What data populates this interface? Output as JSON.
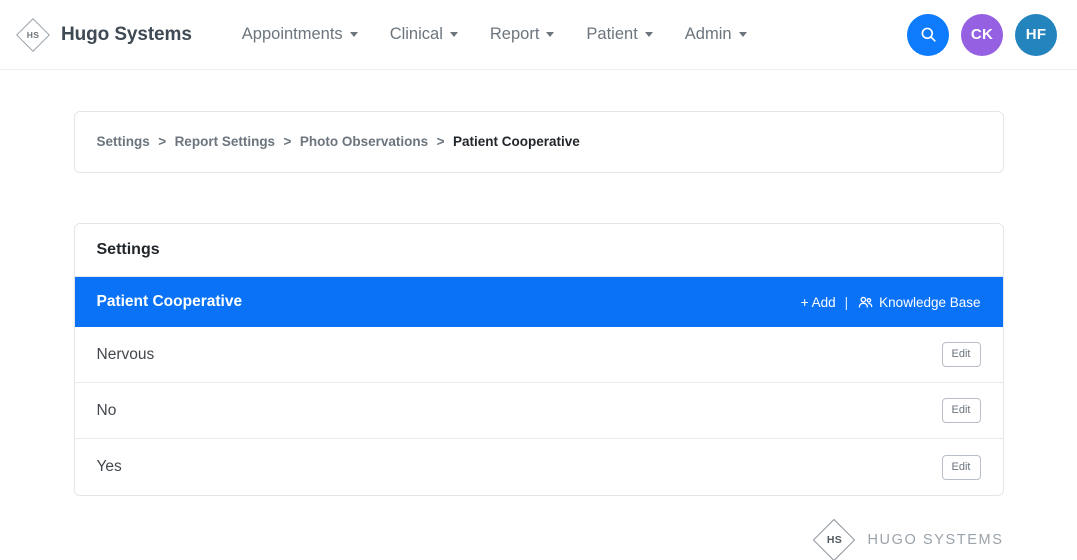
{
  "navbar": {
    "logo_text": "HS",
    "brand": "Hugo Systems",
    "menu": [
      {
        "label": "Appointments"
      },
      {
        "label": "Clinical"
      },
      {
        "label": "Report"
      },
      {
        "label": "Patient"
      },
      {
        "label": "Admin"
      }
    ],
    "search_icon": "search-icon",
    "avatars": [
      {
        "initials": "CK",
        "color": "#9561e2"
      },
      {
        "initials": "HF",
        "color": "#2484bd"
      }
    ],
    "search_color": "#0d7bfb"
  },
  "breadcrumb": {
    "items": [
      {
        "label": "Settings",
        "active": false
      },
      {
        "label": "Report Settings",
        "active": false
      },
      {
        "label": "Photo Observations",
        "active": false
      },
      {
        "label": "Patient Cooperative",
        "active": true
      }
    ],
    "separator": ">"
  },
  "settings": {
    "card_title": "Settings",
    "section_title": "Patient Cooperative",
    "accent_color": "#0a72f7",
    "actions": {
      "add_label": "+  Add",
      "divider": "|",
      "knowledge_base_label": "Knowledge Base",
      "knowledge_base_icon": "users-icon"
    },
    "rows": [
      {
        "label": "Nervous",
        "button": "Edit"
      },
      {
        "label": "No",
        "button": "Edit"
      },
      {
        "label": "Yes",
        "button": "Edit"
      }
    ]
  },
  "footer": {
    "logo_text": "HS",
    "name": "HUGO SYSTEMS"
  }
}
